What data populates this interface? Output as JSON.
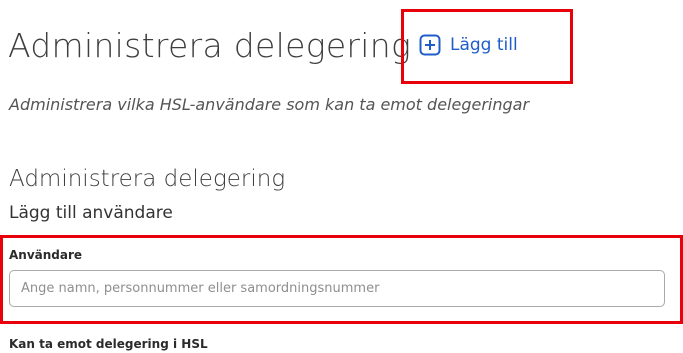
{
  "header": {
    "title": "Administrera delegering",
    "add_button_label": "Lägg till",
    "add_icon": "plus-square-icon",
    "subtitle": "Administrera vilka HSL-användare som kan ta emot delegeringar"
  },
  "form": {
    "section_title": "Administrera delegering",
    "section_subtitle": "Lägg till användare",
    "user_label": "Användare",
    "user_value": "",
    "user_placeholder": "Ange namn, personnummer eller samordningsnummer",
    "can_receive_label": "Kan ta emot delegering i HSL"
  },
  "colors": {
    "link": "#1f5ec9",
    "highlight": "#e8000b"
  }
}
